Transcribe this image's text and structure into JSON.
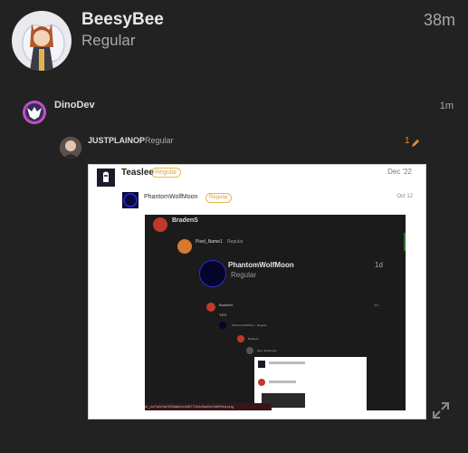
{
  "header": {
    "username": "BeesyBee",
    "role": "Regular",
    "time": "38m"
  },
  "reply1": {
    "username": "DinoDev",
    "time": "1m"
  },
  "reply2": {
    "username": "JUSTPLAINOP",
    "role": "Regular",
    "edit_count": "1"
  },
  "screenshot": {
    "post": {
      "username": "Teaslee",
      "badge": "Regular",
      "date": "Dec '22"
    },
    "reply": {
      "username": "PhantomWolfMoon",
      "badge": "Regular",
      "date": "Oct 12"
    },
    "inner": {
      "poster": "BradenS",
      "reply_user": "Pixel_Name1",
      "reply_role": "Regular",
      "quote_user": "PhantomWolfMoon",
      "quote_role": "Regular",
      "quote_time": "1d",
      "nested_user": "BradenS",
      "nested_time": "2m",
      "nested_text": "YES",
      "nested2_user": "PhantomWolfMoon",
      "nested2_role": "Regular",
      "nested3_user": "BradenS",
      "nested4_user": "idee_Studioman",
      "url": "d/_/cc7a2e3a7830a8c0c2e8771b4d9a49c1bb99ed.png"
    }
  },
  "colors": {
    "background": "#222222",
    "accent": "#e38e2a",
    "badge": "#e9b64a"
  },
  "icons": {
    "edit": "pencil-icon",
    "expand": "expand-icon"
  }
}
